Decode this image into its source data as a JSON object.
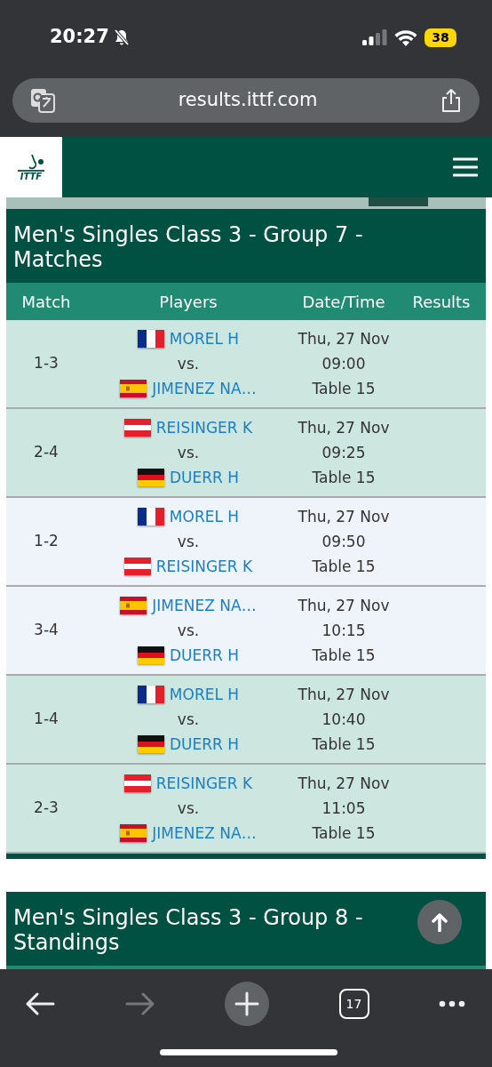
{
  "status_bar": {
    "time": "20:27",
    "battery": "38"
  },
  "address_bar": {
    "url": "results.ittf.com"
  },
  "site_header": {
    "logo": "ITTF"
  },
  "sections": [
    {
      "title": "Men's Singles Class 3 - Group 7 - Matches",
      "columns": [
        "Match",
        "Players",
        "Date/Time",
        "Results"
      ],
      "rows": [
        {
          "match": "1-3",
          "player_1": {
            "name": "MOREL H",
            "kind": "fra"
          },
          "vs": "vs.",
          "player_2": {
            "name": "JIMENEZ NA…",
            "kind": "esp"
          },
          "date": "Thu, 27 Nov",
          "time": "09:00",
          "table": "Table 15",
          "color": "#cde6df"
        },
        {
          "match": "2-4",
          "player_1": {
            "name": "REISINGER K",
            "kind": "aut"
          },
          "vs": "vs.",
          "player_2": {
            "name": "DUERR H",
            "kind": "ger"
          },
          "date": "Thu, 27 Nov",
          "time": "09:25",
          "table": "Table 15",
          "color": "#cde6df"
        },
        {
          "match": "1-2",
          "player_1": {
            "name": "MOREL H",
            "kind": "fra"
          },
          "vs": "vs.",
          "player_2": {
            "name": "REISINGER K",
            "kind": "aut"
          },
          "date": "Thu, 27 Nov",
          "time": "09:50",
          "table": "Table 15",
          "color": "#eef4fa"
        },
        {
          "match": "3-4",
          "player_1": {
            "name": "JIMENEZ NA…",
            "kind": "esp"
          },
          "vs": "vs.",
          "player_2": {
            "name": "DUERR H",
            "kind": "ger"
          },
          "date": "Thu, 27 Nov",
          "time": "10:15",
          "table": "Table 15",
          "color": "#eef4fa"
        },
        {
          "match": "1-4",
          "player_1": {
            "name": "MOREL H",
            "kind": "fra"
          },
          "vs": "vs.",
          "player_2": {
            "name": "DUERR H",
            "kind": "ger"
          },
          "date": "Thu, 27 Nov",
          "time": "10:40",
          "table": "Table 15",
          "color": "#cde6df"
        },
        {
          "match": "2-3",
          "player_1": {
            "name": "REISINGER K",
            "kind": "aut"
          },
          "vs": "vs.",
          "player_2": {
            "name": "JIMENEZ NA…",
            "kind": "esp"
          },
          "date": "Thu, 27 Nov",
          "time": "11:05",
          "table": "Table 15",
          "color": "#cde6df"
        }
      ]
    },
    {
      "title": "Men's Singles Class 3 - Group 8 - Standings"
    }
  ],
  "toolbar": {
    "forward_disabled": true,
    "tab_count": "17"
  }
}
